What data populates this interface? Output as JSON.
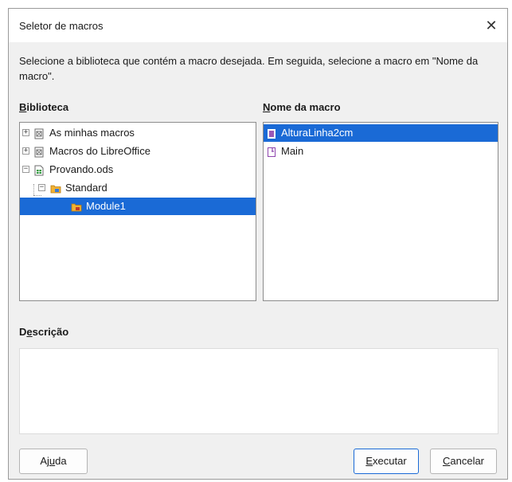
{
  "dialog": {
    "title": "Seletor de macros",
    "close_glyph": "✕",
    "instructions": "Selecione a biblioteca que contém a macro desejada. Em seguida, selecione a macro em \"Nome da macro\"."
  },
  "library": {
    "label_mnemonic": "B",
    "label_rest": "iblioteca",
    "items": [
      {
        "label": "As minhas macros",
        "expander": "+",
        "icon": "macro-library-icon",
        "level": 0,
        "selected": false
      },
      {
        "label": "Macros do LibreOffice",
        "expander": "+",
        "icon": "macro-library-icon",
        "level": 0,
        "selected": false
      },
      {
        "label": "Provando.ods",
        "expander": "−",
        "icon": "spreadsheet-document-icon",
        "level": 0,
        "selected": false
      },
      {
        "label": "Standard",
        "expander": "−",
        "icon": "basic-library-icon",
        "level": 1,
        "selected": false
      },
      {
        "label": "Module1",
        "expander": "",
        "icon": "basic-module-icon",
        "level": 2,
        "selected": true
      }
    ]
  },
  "macros": {
    "label_mnemonic": "N",
    "label_rest": "ome da macro",
    "items": [
      {
        "label": "AlturaLinha2cm",
        "icon": "macro-icon",
        "selected": true
      },
      {
        "label": "Main",
        "icon": "macro-icon",
        "selected": false
      }
    ]
  },
  "description": {
    "label_before": "D",
    "label_mnemonic": "e",
    "label_rest": "scrição"
  },
  "buttons": {
    "help_before": "Aj",
    "help_mnemonic": "u",
    "help_after": "da",
    "run_mnemonic": "E",
    "run_rest": "xecutar",
    "cancel_mnemonic": "C",
    "cancel_rest": "ancelar"
  },
  "colors": {
    "selection": "#1a6ad6",
    "dialog_bg": "#f0f0f0"
  }
}
